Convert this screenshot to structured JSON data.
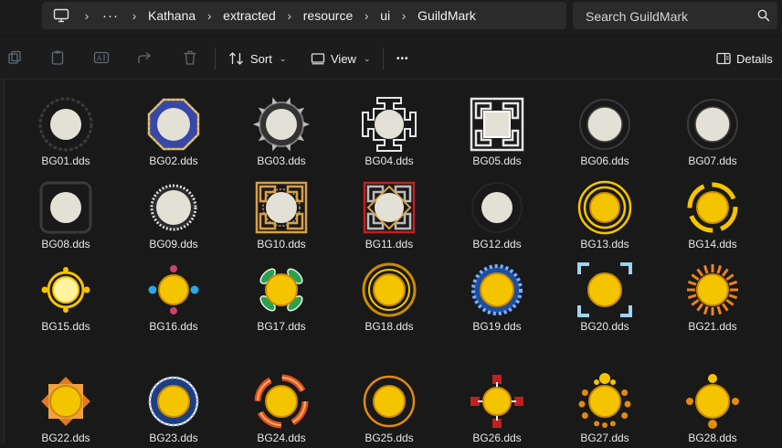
{
  "breadcrumb": {
    "overflow": "···",
    "items": [
      "Kathana",
      "extracted",
      "resource",
      "ui",
      "GuildMark"
    ]
  },
  "search": {
    "placeholder": "Search GuildMark"
  },
  "toolbar": {
    "sort_label": "Sort",
    "view_label": "View",
    "more": "•••",
    "details_label": "Details"
  },
  "icons": [
    "monitor-icon",
    "search-icon",
    "new-icon",
    "paste-icon",
    "rename-icon",
    "share-icon",
    "delete-icon",
    "sort-icon",
    "view-icon",
    "more-icon",
    "details-pane-icon"
  ],
  "colors": {
    "background": "#191919",
    "bar": "#2b2b2b",
    "gold": "#f5c400",
    "text": "#e6e6e6"
  },
  "files": [
    {
      "name": "BG01.dds",
      "style": "lace-dark"
    },
    {
      "name": "BG02.dds",
      "style": "octagon-blue"
    },
    {
      "name": "BG03.dds",
      "style": "spiked-dark"
    },
    {
      "name": "BG04.dds",
      "style": "key-cross"
    },
    {
      "name": "BG05.dds",
      "style": "key-square"
    },
    {
      "name": "BG06.dds",
      "style": "ring-dark"
    },
    {
      "name": "BG07.dds",
      "style": "ring-dark"
    },
    {
      "name": "BG08.dds",
      "style": "square-dark"
    },
    {
      "name": "BG09.dds",
      "style": "pearl-ring"
    },
    {
      "name": "BG10.dds",
      "style": "key-gold"
    },
    {
      "name": "BG11.dds",
      "style": "key-red"
    },
    {
      "name": "BG12.dds",
      "style": "plain-dark"
    },
    {
      "name": "BG13.dds",
      "style": "gold-double-ring"
    },
    {
      "name": "BG14.dds",
      "style": "gold-bracket"
    },
    {
      "name": "BG15.dds",
      "style": "gold-dots"
    },
    {
      "name": "BG16.dds",
      "style": "gem-cross"
    },
    {
      "name": "BG17.dds",
      "style": "green-leaves"
    },
    {
      "name": "BG18.dds",
      "style": "gold-ring"
    },
    {
      "name": "BG19.dds",
      "style": "blue-greek"
    },
    {
      "name": "BG20.dds",
      "style": "blue-corners"
    },
    {
      "name": "BG21.dds",
      "style": "sunburst"
    },
    {
      "name": "BG22.dds",
      "style": "orange-star"
    },
    {
      "name": "BG23.dds",
      "style": "blue-ring"
    },
    {
      "name": "BG24.dds",
      "style": "orange-arcs"
    },
    {
      "name": "BG25.dds",
      "style": "thin-orange-ring"
    },
    {
      "name": "BG26.dds",
      "style": "red-cross"
    },
    {
      "name": "BG27.dds",
      "style": "gold-beads"
    },
    {
      "name": "BG28.dds",
      "style": "orange-cross-dots"
    }
  ]
}
